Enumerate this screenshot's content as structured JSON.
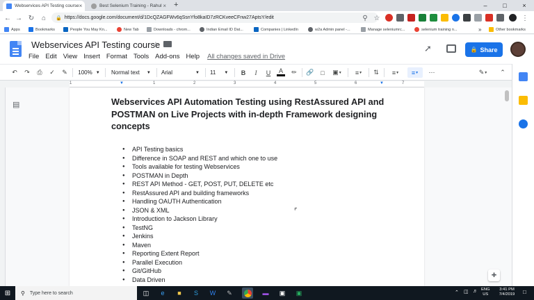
{
  "browser": {
    "tabs": [
      {
        "title": "Webservices API Testing course",
        "close": "×"
      },
      {
        "title": "Best Selenium Training - Rahul",
        "close": "×"
      }
    ],
    "new_tab": "+",
    "window_controls": {
      "minimize": "–",
      "maximize": "□",
      "close": "×"
    },
    "url": "https://docs.google.com/document/d/1DcQZAGFWv6qSsnYfo8kaID7zRCKveeCFnw27AptsY/edit",
    "bookmarks": [
      "Apps",
      "Bookmarks",
      "People You May Kn...",
      "New Tab",
      "Downloads - chrom...",
      "Indian Email ID Dat...",
      "Companies | LinkedIn",
      "w2a Admin panel -...",
      "Manage seleniumrc...",
      "selenium training n..."
    ],
    "bookmarks_overflow": "»",
    "other_bookmarks": "Other bookmarks",
    "accent_color": "#1a73e8"
  },
  "docs": {
    "title": "Webservices API Testing course",
    "menu": [
      "File",
      "Edit",
      "View",
      "Insert",
      "Format",
      "Tools",
      "Add-ons",
      "Help"
    ],
    "save_status": "All changes saved in Drive",
    "share_label": "Share",
    "toolbar": {
      "zoom": "100%",
      "style": "Normal text",
      "font": "Arial",
      "font_size": "11",
      "bold": "B",
      "italic": "I",
      "underline": "U",
      "text_color": "A"
    },
    "ruler_numbers": [
      "1",
      "1",
      "2",
      "3",
      "4",
      "5",
      "6",
      "7"
    ],
    "heading": "Webservices API Automation Testing using RestAssured API and POSTMAN on Live Projects with in-depth Framework designing concepts",
    "bullets": [
      "API Testing basics",
      "Difference in SOAP and REST and which one to use",
      "Tools available for testing Webservices",
      "POSTMAN in Depth",
      "REST API Method - GET, POST, PUT, DELETE etc",
      "RestAssured API and building frameworks",
      "Handling OAUTH Authentication",
      "JSON & XML",
      "Introduction to Jackson Library",
      "TestNG",
      "Jenkins",
      "Maven",
      "Reporting Extent Report",
      "Parallel Execution",
      "Git/GitHub",
      "Data Driven"
    ]
  },
  "taskbar": {
    "search_placeholder": "Type here to search",
    "lang": "ENG",
    "region": "US",
    "time": "3:41 PM",
    "date": "7/4/2019"
  }
}
